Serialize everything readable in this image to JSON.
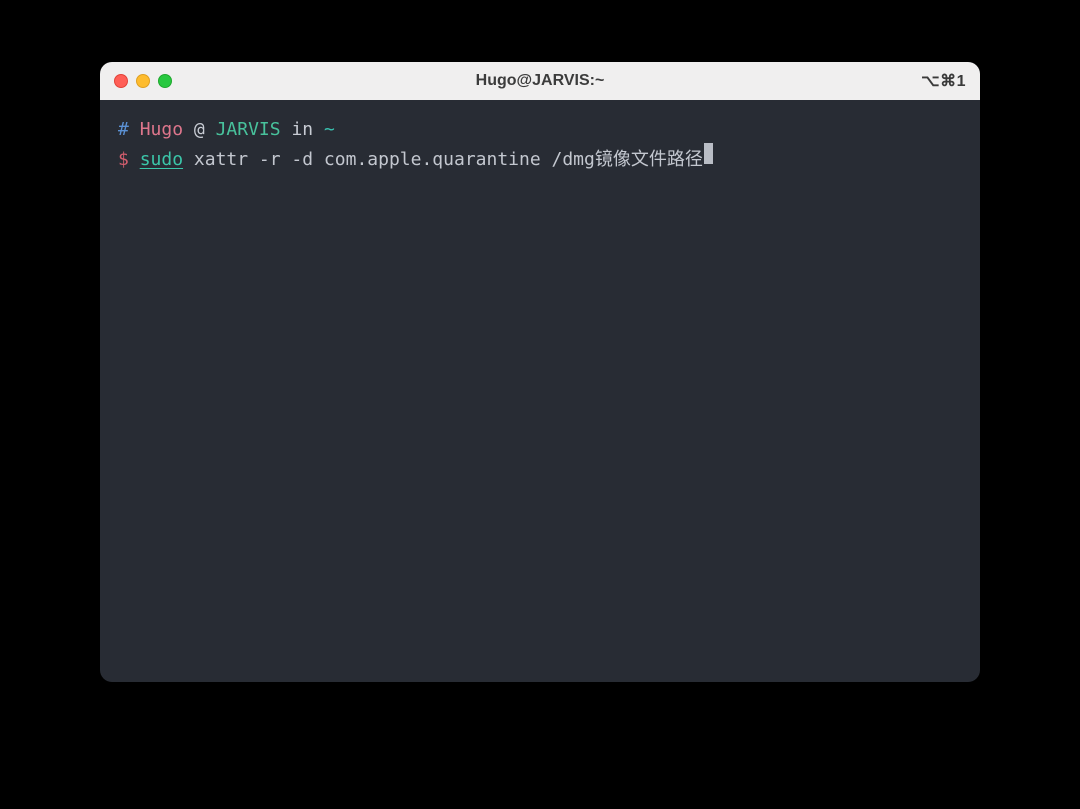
{
  "window": {
    "title": "Hugo@JARVIS:~",
    "right_indicator": "⌥⌘1"
  },
  "prompt_context": {
    "hash": "#",
    "user": "Hugo",
    "at": "@",
    "host": "JARVIS",
    "in": "in",
    "path": "~"
  },
  "command_line": {
    "symbol": "$",
    "sudo": "sudo",
    "rest": "xattr -r -d com.apple.quarantine /dmg镜像文件路径"
  }
}
